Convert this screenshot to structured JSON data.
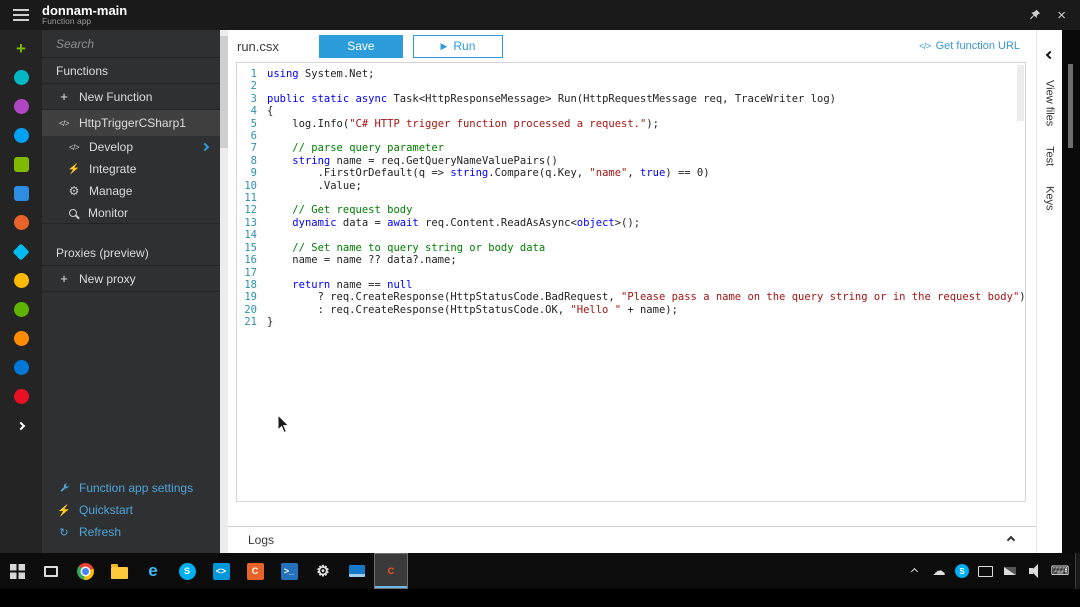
{
  "topbar": {
    "title": "donnam-main",
    "subtitle": "Function app"
  },
  "colors": {
    "accent": "#2d9cdb",
    "link_blue": "#4da6dc",
    "keyword": "#0000ff",
    "string": "#a31515",
    "comment": "#008000",
    "line_number": "#2b91af",
    "sidebar_bg": "#2f3031",
    "topbar_bg": "#1a1a1a"
  },
  "icon_glyphs": {
    "plus": "+",
    "code": "</>",
    "lightning": "⚡",
    "gear": "⚙",
    "refresh": "↻"
  },
  "icon_rail": {
    "items": [
      {
        "name": "new",
        "glyph": "+",
        "color": "#7fba00"
      },
      {
        "name": "service-1",
        "shape": "circle",
        "color": "#00b7c3"
      },
      {
        "name": "service-2",
        "shape": "circle",
        "color": "#b146c2"
      },
      {
        "name": "service-3",
        "shape": "circle",
        "color": "#00a1f1"
      },
      {
        "name": "service-4",
        "shape": "square",
        "color": "#7fba00"
      },
      {
        "name": "service-5",
        "shape": "square",
        "color": "#2e8de0"
      },
      {
        "name": "service-6",
        "shape": "circle",
        "color": "#e8632a"
      },
      {
        "name": "service-7",
        "shape": "diamond",
        "color": "#00bcf2"
      },
      {
        "name": "service-8",
        "shape": "circle",
        "color": "#ffb900"
      },
      {
        "name": "service-9",
        "shape": "circle",
        "color": "#5db300"
      },
      {
        "name": "service-10",
        "shape": "circle",
        "color": "#ff8c00"
      },
      {
        "name": "service-11",
        "shape": "circle",
        "color": "#0078d7"
      },
      {
        "name": "service-12",
        "shape": "circle",
        "color": "#e81123"
      },
      {
        "name": "more",
        "chev": true
      }
    ]
  },
  "sidebar": {
    "search_placeholder": "Search",
    "items": [
      {
        "id": "functions",
        "label": "Functions",
        "divider": true
      },
      {
        "id": "new-function",
        "label": "New Function",
        "icon": "plus",
        "divider": true
      },
      {
        "id": "httptriggercsharp1",
        "label": "HttpTriggerCSharp1",
        "icon": "code",
        "selected": true
      },
      {
        "id": "develop",
        "label": "Develop",
        "icon": "code",
        "sub": true,
        "chevron": true
      },
      {
        "id": "integrate",
        "label": "Integrate",
        "icon": "lightning",
        "sub": true
      },
      {
        "id": "manage",
        "label": "Manage",
        "icon": "gear",
        "sub": true
      },
      {
        "id": "monitor",
        "label": "Monitor",
        "icon": "search",
        "sub": true,
        "divider": true
      },
      {
        "id": "proxies",
        "label": "Proxies (preview)",
        "gap": true,
        "divider": true
      },
      {
        "id": "new-proxy",
        "label": "New proxy",
        "icon": "plus",
        "divider": true
      }
    ],
    "footer_links": [
      {
        "id": "function-app-settings",
        "label": "Function app settings",
        "icon": "wrench"
      },
      {
        "id": "quickstart",
        "label": "Quickstart",
        "icon": "lightning"
      },
      {
        "id": "refresh",
        "label": "Refresh",
        "icon": "refresh"
      }
    ]
  },
  "editor": {
    "filename": "run.csx",
    "save_label": "Save",
    "run_label": "Run",
    "get_function_url_label": "Get function URL"
  },
  "code": {
    "lines": [
      {
        "tokens": [
          [
            "k",
            "using"
          ],
          [
            "p",
            " System.Net;"
          ]
        ]
      },
      {
        "tokens": []
      },
      {
        "tokens": [
          [
            "k",
            "public"
          ],
          [
            "p",
            " "
          ],
          [
            "k",
            "static"
          ],
          [
            "p",
            " "
          ],
          [
            "k",
            "async"
          ],
          [
            "p",
            " Task<HttpResponseMessage> Run(HttpRequestMessage req, TraceWriter log)"
          ]
        ]
      },
      {
        "tokens": [
          [
            "p",
            "{"
          ]
        ]
      },
      {
        "tokens": [
          [
            "p",
            "    log.Info("
          ],
          [
            "s",
            "\"C# HTTP trigger function processed a request.\""
          ],
          [
            "p",
            ");"
          ]
        ]
      },
      {
        "tokens": []
      },
      {
        "tokens": [
          [
            "p",
            "    "
          ],
          [
            "c",
            "// parse query parameter"
          ]
        ]
      },
      {
        "tokens": [
          [
            "p",
            "    "
          ],
          [
            "k",
            "string"
          ],
          [
            "p",
            " name = req.GetQueryNameValuePairs()"
          ]
        ]
      },
      {
        "tokens": [
          [
            "p",
            "        .FirstOrDefault(q => "
          ],
          [
            "k",
            "string"
          ],
          [
            "p",
            ".Compare(q.Key, "
          ],
          [
            "s",
            "\"name\""
          ],
          [
            "p",
            ", "
          ],
          [
            "k",
            "true"
          ],
          [
            "p",
            ") == 0)"
          ]
        ]
      },
      {
        "tokens": [
          [
            "p",
            "        .Value;"
          ]
        ]
      },
      {
        "tokens": []
      },
      {
        "tokens": [
          [
            "p",
            "    "
          ],
          [
            "c",
            "// Get request body"
          ]
        ]
      },
      {
        "tokens": [
          [
            "p",
            "    "
          ],
          [
            "k",
            "dynamic"
          ],
          [
            "p",
            " data = "
          ],
          [
            "k",
            "await"
          ],
          [
            "p",
            " req.Content.ReadAsAsync<"
          ],
          [
            "k",
            "object"
          ],
          [
            "p",
            ">();"
          ]
        ]
      },
      {
        "tokens": []
      },
      {
        "tokens": [
          [
            "p",
            "    "
          ],
          [
            "c",
            "// Set name to query string or body data"
          ]
        ]
      },
      {
        "tokens": [
          [
            "p",
            "    name = name ?? data?.name;"
          ]
        ]
      },
      {
        "tokens": []
      },
      {
        "tokens": [
          [
            "p",
            "    "
          ],
          [
            "k",
            "return"
          ],
          [
            "p",
            " name == "
          ],
          [
            "k",
            "null"
          ]
        ]
      },
      {
        "tokens": [
          [
            "p",
            "        ? req.CreateResponse(HttpStatusCode.BadRequest, "
          ],
          [
            "s",
            "\"Please pass a name on the query string or in the request body\""
          ],
          [
            "p",
            ")"
          ]
        ]
      },
      {
        "tokens": [
          [
            "p",
            "        : req.CreateResponse(HttpStatusCode.OK, "
          ],
          [
            "s",
            "\"Hello \""
          ],
          [
            "p",
            " + name);"
          ]
        ]
      },
      {
        "tokens": [
          [
            "p",
            "}"
          ]
        ]
      }
    ]
  },
  "right_rail": {
    "tabs": [
      {
        "id": "view-files",
        "label": "View files"
      },
      {
        "id": "test",
        "label": "Test"
      },
      {
        "id": "keys",
        "label": "Keys"
      }
    ]
  },
  "logs": {
    "label": "Logs"
  },
  "taskbar": {
    "apps": [
      {
        "name": "start",
        "cls": "start"
      },
      {
        "name": "task-view",
        "cls": "taskview"
      },
      {
        "name": "chrome",
        "cls": "chrome"
      },
      {
        "name": "file-explorer",
        "cls": "folder"
      },
      {
        "name": "edge",
        "cls": "edge",
        "glyph": "e",
        "fg": "#3fbcf5"
      },
      {
        "name": "skype",
        "cls": "circle",
        "glyph": "S",
        "bg": "#00aff0",
        "fg": "#ffffff"
      },
      {
        "name": "vscode",
        "glyph": "<>",
        "bg": "#0098db",
        "fg": "#ffffff"
      },
      {
        "name": "app-c",
        "glyph": "C",
        "bg": "#e8632a",
        "fg": "#ffffff"
      },
      {
        "name": "powershell",
        "glyph": ">_",
        "bg": "#2671be",
        "fg": "#ffffff"
      },
      {
        "name": "settings",
        "cls": "gear",
        "glyph": "⚙",
        "fg": "#e0e0e0"
      },
      {
        "name": "monitor-app",
        "cls": "monapp"
      },
      {
        "name": "recorder",
        "glyph": "C",
        "fg": "#ff5722",
        "active": true
      }
    ],
    "tray": [
      {
        "name": "hidden-icons",
        "cls": "chevup"
      },
      {
        "name": "onedrive",
        "glyph": "☁",
        "fg": "#e0e0e0"
      },
      {
        "name": "skype-tray",
        "cls": "circle-sm",
        "glyph": "S",
        "bg": "#00aff0",
        "fg": "#ffffff"
      },
      {
        "name": "display",
        "cls": "monitor-tray"
      },
      {
        "name": "network",
        "cls": "net"
      },
      {
        "name": "volume",
        "cls": "spk"
      },
      {
        "name": "keyboard",
        "glyph": "⌨",
        "fg": "#e0e0e0"
      }
    ]
  }
}
